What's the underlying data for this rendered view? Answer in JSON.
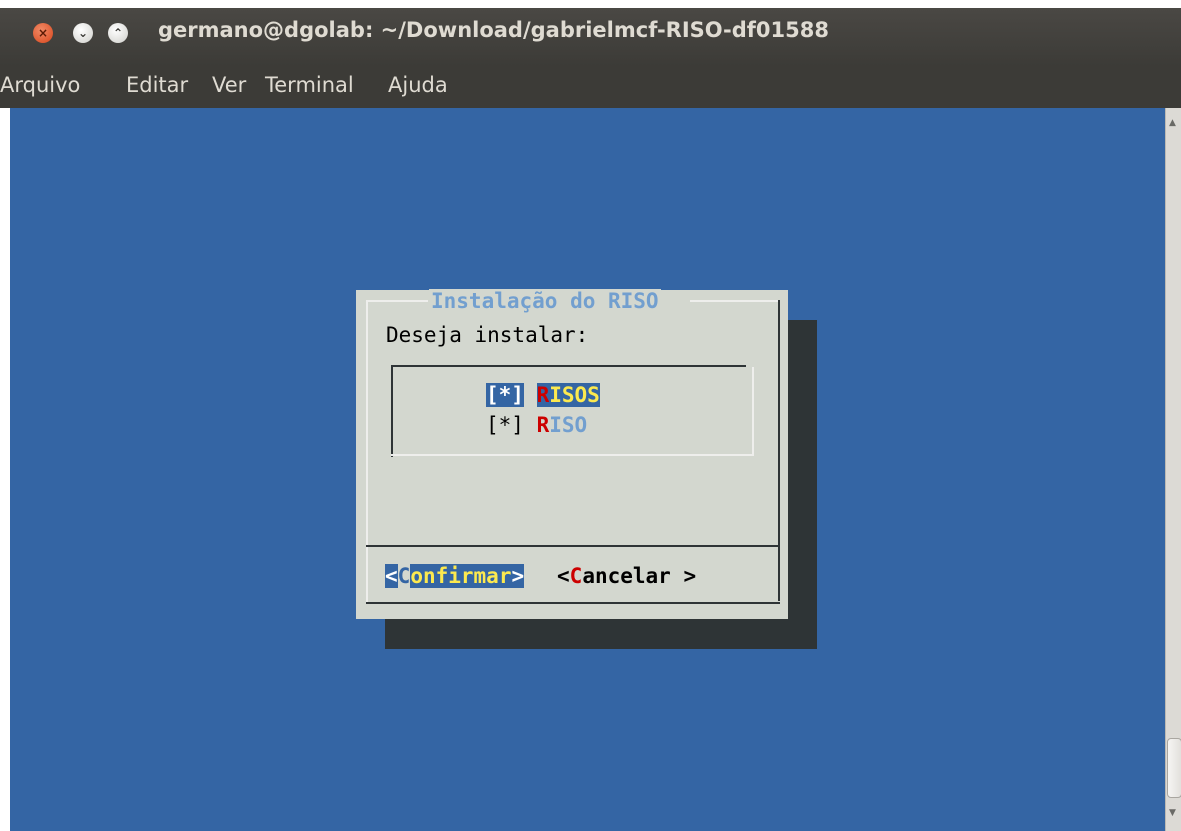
{
  "window": {
    "title": "germano@dgolab: ~/Download/gabrielmcf-RISO-df01588",
    "controls": {
      "close": "×",
      "minimize": "⌄",
      "maximize": "⌃"
    }
  },
  "menubar": {
    "items": [
      "Arquivo",
      "Editar",
      "Ver",
      "Terminal",
      "Ajuda"
    ]
  },
  "dialog": {
    "title": "Instalação do RISO",
    "prompt": "Deseja instalar:",
    "options": [
      {
        "mark": "[*]",
        "hotkey": "R",
        "rest": "ISOS",
        "selected": true
      },
      {
        "mark": "[*]",
        "hotkey": "R",
        "rest": "ISO",
        "selected": false
      }
    ],
    "buttons": {
      "confirm": {
        "open": "<",
        "hotkey": "C",
        "rest": "onfirmar",
        "close": ">"
      },
      "cancel": {
        "open": "<",
        "hotkey": "C",
        "rest": "ancelar",
        "close": " >"
      }
    }
  },
  "colors": {
    "terminal_bg": "#3465a4",
    "dialog_bg": "#d3d7cf",
    "shadow": "#2e3436",
    "title_text": "#729fcf",
    "hotkey": "#cc0000",
    "selected_text": "#fce94f"
  }
}
